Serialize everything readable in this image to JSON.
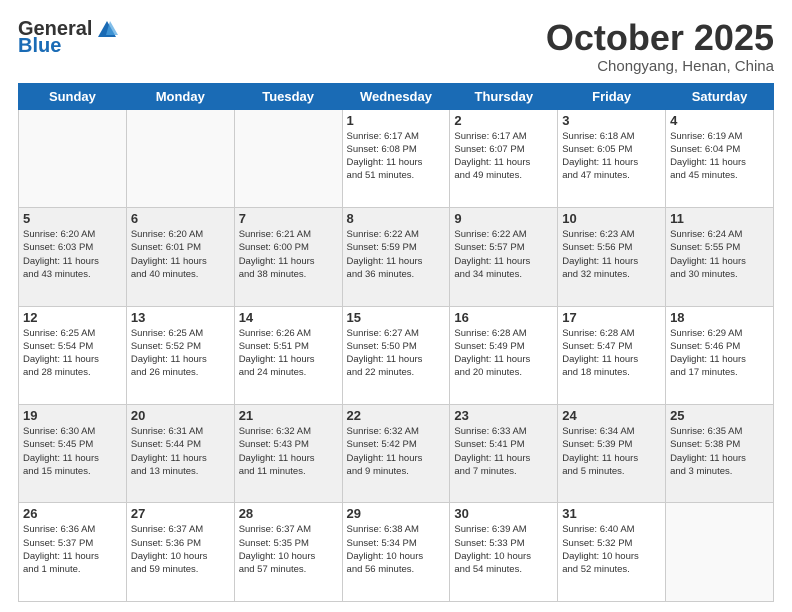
{
  "logo": {
    "general": "General",
    "blue": "Blue"
  },
  "header": {
    "month": "October 2025",
    "location": "Chongyang, Henan, China"
  },
  "weekdays": [
    "Sunday",
    "Monday",
    "Tuesday",
    "Wednesday",
    "Thursday",
    "Friday",
    "Saturday"
  ],
  "weeks": [
    [
      {
        "day": "",
        "info": ""
      },
      {
        "day": "",
        "info": ""
      },
      {
        "day": "",
        "info": ""
      },
      {
        "day": "1",
        "info": "Sunrise: 6:17 AM\nSunset: 6:08 PM\nDaylight: 11 hours\nand 51 minutes."
      },
      {
        "day": "2",
        "info": "Sunrise: 6:17 AM\nSunset: 6:07 PM\nDaylight: 11 hours\nand 49 minutes."
      },
      {
        "day": "3",
        "info": "Sunrise: 6:18 AM\nSunset: 6:05 PM\nDaylight: 11 hours\nand 47 minutes."
      },
      {
        "day": "4",
        "info": "Sunrise: 6:19 AM\nSunset: 6:04 PM\nDaylight: 11 hours\nand 45 minutes."
      }
    ],
    [
      {
        "day": "5",
        "info": "Sunrise: 6:20 AM\nSunset: 6:03 PM\nDaylight: 11 hours\nand 43 minutes."
      },
      {
        "day": "6",
        "info": "Sunrise: 6:20 AM\nSunset: 6:01 PM\nDaylight: 11 hours\nand 40 minutes."
      },
      {
        "day": "7",
        "info": "Sunrise: 6:21 AM\nSunset: 6:00 PM\nDaylight: 11 hours\nand 38 minutes."
      },
      {
        "day": "8",
        "info": "Sunrise: 6:22 AM\nSunset: 5:59 PM\nDaylight: 11 hours\nand 36 minutes."
      },
      {
        "day": "9",
        "info": "Sunrise: 6:22 AM\nSunset: 5:57 PM\nDaylight: 11 hours\nand 34 minutes."
      },
      {
        "day": "10",
        "info": "Sunrise: 6:23 AM\nSunset: 5:56 PM\nDaylight: 11 hours\nand 32 minutes."
      },
      {
        "day": "11",
        "info": "Sunrise: 6:24 AM\nSunset: 5:55 PM\nDaylight: 11 hours\nand 30 minutes."
      }
    ],
    [
      {
        "day": "12",
        "info": "Sunrise: 6:25 AM\nSunset: 5:54 PM\nDaylight: 11 hours\nand 28 minutes."
      },
      {
        "day": "13",
        "info": "Sunrise: 6:25 AM\nSunset: 5:52 PM\nDaylight: 11 hours\nand 26 minutes."
      },
      {
        "day": "14",
        "info": "Sunrise: 6:26 AM\nSunset: 5:51 PM\nDaylight: 11 hours\nand 24 minutes."
      },
      {
        "day": "15",
        "info": "Sunrise: 6:27 AM\nSunset: 5:50 PM\nDaylight: 11 hours\nand 22 minutes."
      },
      {
        "day": "16",
        "info": "Sunrise: 6:28 AM\nSunset: 5:49 PM\nDaylight: 11 hours\nand 20 minutes."
      },
      {
        "day": "17",
        "info": "Sunrise: 6:28 AM\nSunset: 5:47 PM\nDaylight: 11 hours\nand 18 minutes."
      },
      {
        "day": "18",
        "info": "Sunrise: 6:29 AM\nSunset: 5:46 PM\nDaylight: 11 hours\nand 17 minutes."
      }
    ],
    [
      {
        "day": "19",
        "info": "Sunrise: 6:30 AM\nSunset: 5:45 PM\nDaylight: 11 hours\nand 15 minutes."
      },
      {
        "day": "20",
        "info": "Sunrise: 6:31 AM\nSunset: 5:44 PM\nDaylight: 11 hours\nand 13 minutes."
      },
      {
        "day": "21",
        "info": "Sunrise: 6:32 AM\nSunset: 5:43 PM\nDaylight: 11 hours\nand 11 minutes."
      },
      {
        "day": "22",
        "info": "Sunrise: 6:32 AM\nSunset: 5:42 PM\nDaylight: 11 hours\nand 9 minutes."
      },
      {
        "day": "23",
        "info": "Sunrise: 6:33 AM\nSunset: 5:41 PM\nDaylight: 11 hours\nand 7 minutes."
      },
      {
        "day": "24",
        "info": "Sunrise: 6:34 AM\nSunset: 5:39 PM\nDaylight: 11 hours\nand 5 minutes."
      },
      {
        "day": "25",
        "info": "Sunrise: 6:35 AM\nSunset: 5:38 PM\nDaylight: 11 hours\nand 3 minutes."
      }
    ],
    [
      {
        "day": "26",
        "info": "Sunrise: 6:36 AM\nSunset: 5:37 PM\nDaylight: 11 hours\nand 1 minute."
      },
      {
        "day": "27",
        "info": "Sunrise: 6:37 AM\nSunset: 5:36 PM\nDaylight: 10 hours\nand 59 minutes."
      },
      {
        "day": "28",
        "info": "Sunrise: 6:37 AM\nSunset: 5:35 PM\nDaylight: 10 hours\nand 57 minutes."
      },
      {
        "day": "29",
        "info": "Sunrise: 6:38 AM\nSunset: 5:34 PM\nDaylight: 10 hours\nand 56 minutes."
      },
      {
        "day": "30",
        "info": "Sunrise: 6:39 AM\nSunset: 5:33 PM\nDaylight: 10 hours\nand 54 minutes."
      },
      {
        "day": "31",
        "info": "Sunrise: 6:40 AM\nSunset: 5:32 PM\nDaylight: 10 hours\nand 52 minutes."
      },
      {
        "day": "",
        "info": ""
      }
    ]
  ]
}
